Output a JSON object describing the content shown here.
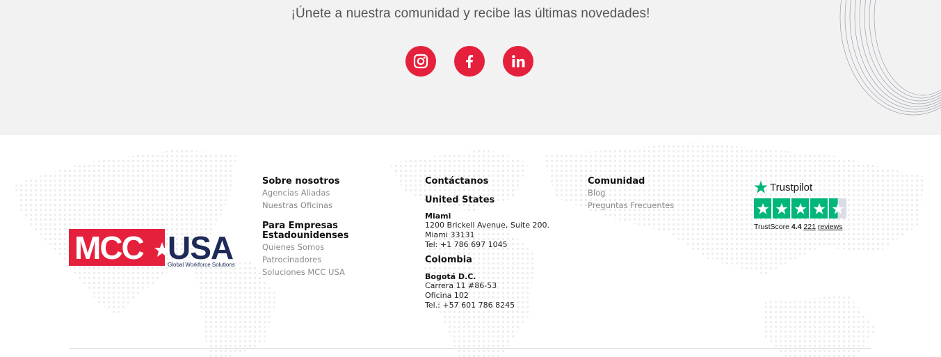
{
  "community": {
    "tagline": "¡Únete a nuestra comunidad y recibe las últimas novedades!",
    "socials": [
      {
        "name": "Instagram",
        "icon": "instagram-icon"
      },
      {
        "name": "Facebook",
        "icon": "facebook-icon"
      },
      {
        "name": "LinkedIn",
        "icon": "linkedin-icon"
      }
    ],
    "accent_color": "#e5203c"
  },
  "brand": {
    "logo_left": "MCC",
    "logo_right": "USA",
    "logo_tagline": "Global Workforce Solutions",
    "red": "#e5203c",
    "navy": "#1e2a57"
  },
  "footer": {
    "about": {
      "heading": "Sobre nosotros",
      "links": [
        "Agencias Aliadas",
        "Nuestras Oficinas"
      ]
    },
    "companies": {
      "heading_line1": "Para Empresas",
      "heading_line2": "Estadounidenses",
      "links": [
        "Quienes Somos",
        "Patrocinadores",
        "Soluciones MCC USA"
      ]
    },
    "contact": {
      "heading": "Contáctanos",
      "us_label": "United States",
      "us_city": "Miami",
      "us_address": [
        "1200 Brickell Avenue, Suite 200.",
        "Miami 33131",
        "Tel: +1 786 697 1045"
      ],
      "co_label": "Colombia",
      "co_city": "Bogotá D.C.",
      "co_address": [
        "Carrera 11 #86-53",
        "Oficina 102",
        "Tel.: +57 601 786 8245"
      ]
    },
    "community": {
      "heading": "Comunidad",
      "links": [
        "Blog",
        "Preguntas Frecuentes"
      ]
    },
    "trustpilot": {
      "brand": "Trustpilot",
      "score_label": "TrustScore",
      "score": "4.4",
      "reviews_count": "221",
      "reviews_label": "reviews",
      "rating": 4.4,
      "star_color": "#00b67a"
    }
  }
}
